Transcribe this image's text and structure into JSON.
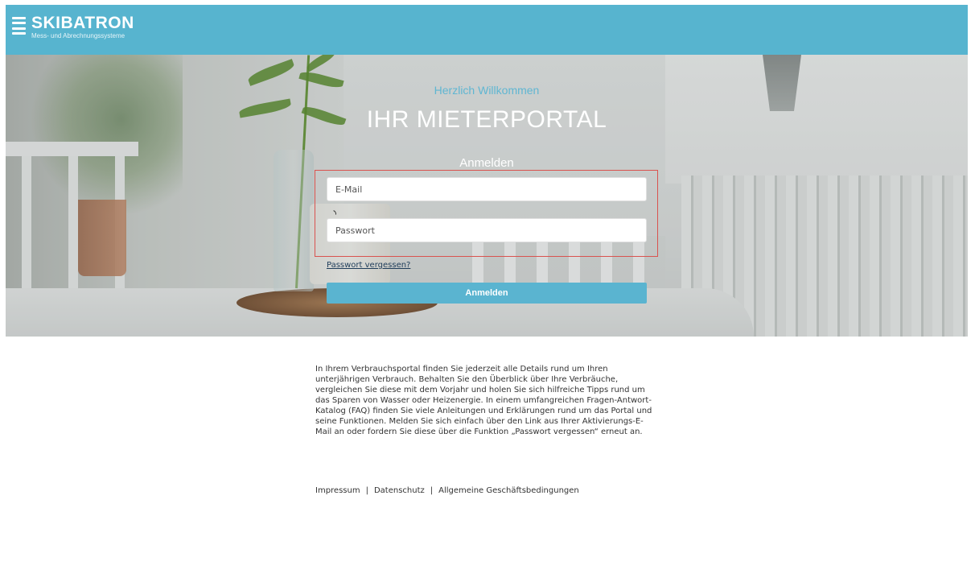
{
  "brand": {
    "name": "SKIBATRON",
    "tagline": "Mess- und Abrechnungssysteme",
    "color": "#57b4cf"
  },
  "hero": {
    "greeting": "Herzlich Willkommen",
    "title": "IHR MIETERPORTAL",
    "login_heading": "Anmelden"
  },
  "login": {
    "email_placeholder": "E-Mail",
    "password_placeholder": "Passwort",
    "forgot_link": "Passwort vergessen?",
    "submit_label": "Anmelden",
    "accent_color": "#5ab4d0",
    "highlight_color": "#d9534f"
  },
  "content": {
    "description": "In Ihrem Verbrauchsportal finden Sie jederzeit alle Details rund um Ihren unterjährigen Verbrauch. Behalten Sie den Überblick über Ihre Verbräuche, vergleichen Sie diese mit dem Vorjahr und holen Sie sich hilfreiche Tipps rund um das Sparen von Wasser oder Heizenergie. In einem umfangreichen Fragen-Antwort-Katalog (FAQ) finden Sie viele Anleitungen und Erklärungen rund um das Portal und seine Funktionen. Melden Sie sich einfach über den Link aus Ihrer Aktivierungs-E-Mail an oder fordern Sie diese über die Funktion „Passwort vergessen“ erneut an."
  },
  "footer": {
    "links": [
      "Impressum",
      "Datenschutz",
      "Allgemeine Geschäftsbedingungen"
    ],
    "separator": "|"
  }
}
